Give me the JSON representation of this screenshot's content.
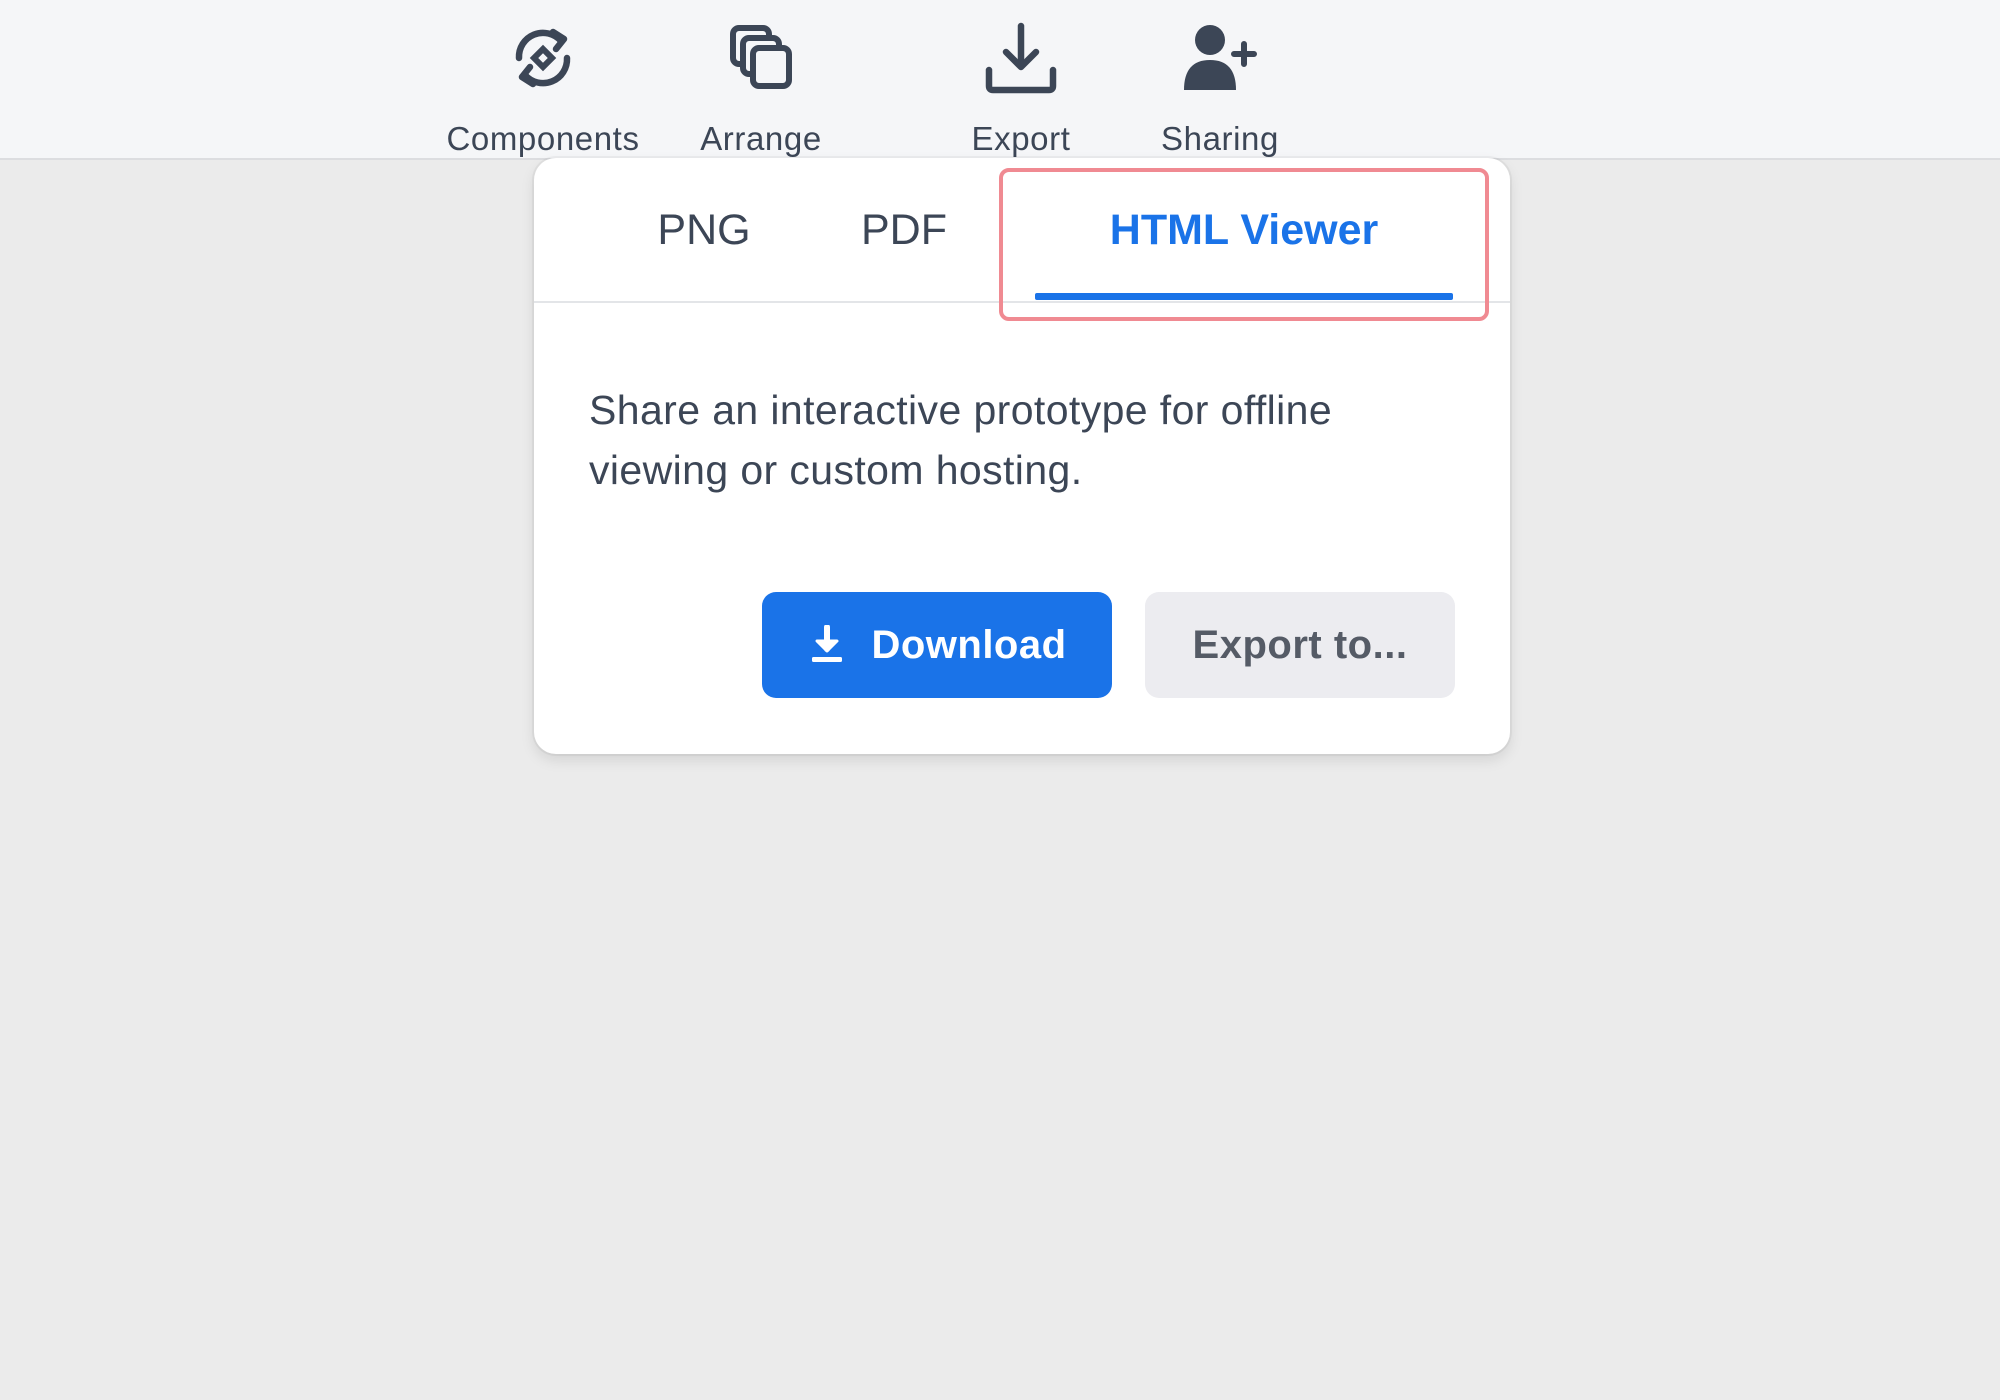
{
  "toolbar": {
    "items": [
      {
        "label": "Components",
        "icon": "components-icon"
      },
      {
        "label": "Arrange",
        "icon": "arrange-icon"
      },
      {
        "label": "Export",
        "icon": "download-icon"
      },
      {
        "label": "Sharing",
        "icon": "add-user-icon"
      }
    ]
  },
  "export_popover": {
    "tabs": [
      {
        "label": "PNG"
      },
      {
        "label": "PDF"
      },
      {
        "label": "HTML Viewer",
        "selected": true
      }
    ],
    "description": "Share an interactive prototype for offline viewing or custom hosting.",
    "download_label": "Download",
    "download_icon": "download-icon",
    "export_to_label": "Export to..."
  },
  "colors": {
    "accent": "#1a73e8",
    "highlight": "#f08a92",
    "text": "#3c4656"
  }
}
